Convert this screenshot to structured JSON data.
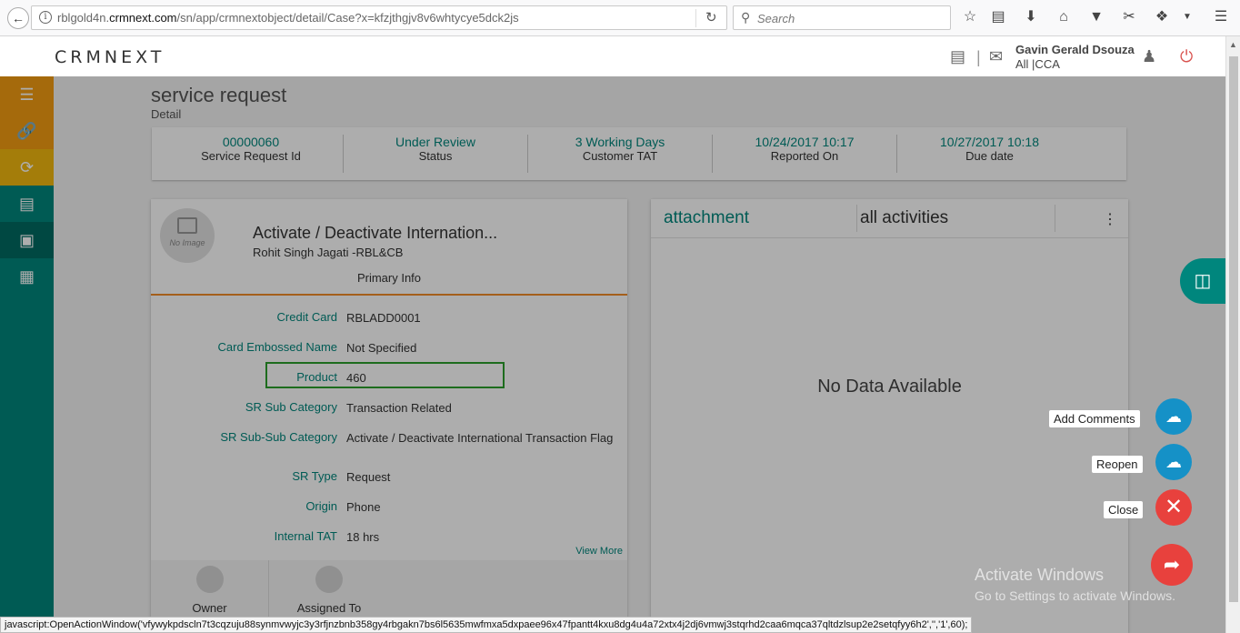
{
  "browser": {
    "url_prefix": "rblgold4n.",
    "url_domain": "crmnext.com",
    "url_path": "/sn/app/crmnextobject/detail/Case?x=kfzjthgjv8v6whtycye5dck2js",
    "search_placeholder": "Search"
  },
  "header": {
    "logo": "CRMNEXT",
    "separator": "|",
    "user_name": "Gavin Gerald Dsouza",
    "user_role": "All |CCA"
  },
  "page": {
    "title": "service request",
    "subtitle": "Detail"
  },
  "kpis": [
    {
      "value": "00000060",
      "label": "Service Request Id"
    },
    {
      "value": "Under Review",
      "label": "Status"
    },
    {
      "value": "3 Working Days",
      "label": "Customer TAT"
    },
    {
      "value": "10/24/2017 10:17",
      "label": "Reported On"
    },
    {
      "value": "10/27/2017 10:18",
      "label": "Due date"
    }
  ],
  "case": {
    "no_image": "No Image",
    "title": "Activate / Deactivate Internation...",
    "customer": "Rohit Singh Jagati -RBL&CB",
    "section": "Primary Info",
    "fields": [
      {
        "label": "Credit Card",
        "value": "RBLADD0001"
      },
      {
        "label": "Card Embossed Name",
        "value": "Not Specified"
      },
      {
        "label": "Product",
        "value": "460"
      },
      {
        "label": "SR Sub Category",
        "value": "Transaction Related"
      },
      {
        "label": "SR Sub-Sub Category",
        "value": "Activate / Deactivate International Transaction Flag"
      },
      {
        "label": "SR Type",
        "value": "Request"
      },
      {
        "label": "Origin",
        "value": "Phone"
      },
      {
        "label": "Internal TAT",
        "value": "18 hrs"
      }
    ],
    "view_more": "View More",
    "people": [
      {
        "label": "Owner"
      },
      {
        "label": "Assigned To"
      }
    ]
  },
  "activity_panel": {
    "tab_attachment": "attachment",
    "tab_activities": "all activities",
    "menu_icon": "⋮",
    "empty_text": "No Data Available"
  },
  "actions": {
    "add_comments": "Add Comments",
    "reopen": "Reopen",
    "close": "Close"
  },
  "watermark": {
    "line1": "Activate Windows",
    "line2": "Go to Settings to activate Windows."
  },
  "status_bar": "javascript:OpenActionWindow('vfywykpdscln7t3cqzuju88synmvwyjc3y3rfjnzbnb358gy4rbgakn7bs6l5635mwfmxa5dxpaee96x47fpantt4kxu8dg4u4a72xtx4j2dj6vmwj3stqrhd2caa6mqca37qltdzlsup2e2setqfyy6h2','','1',60);",
  "colors": {
    "teal": "#00867d",
    "orange": "#f28c28",
    "fab_blue": "#1591c7",
    "fab_red": "#e8413d",
    "highlight": "#2ca02c"
  }
}
